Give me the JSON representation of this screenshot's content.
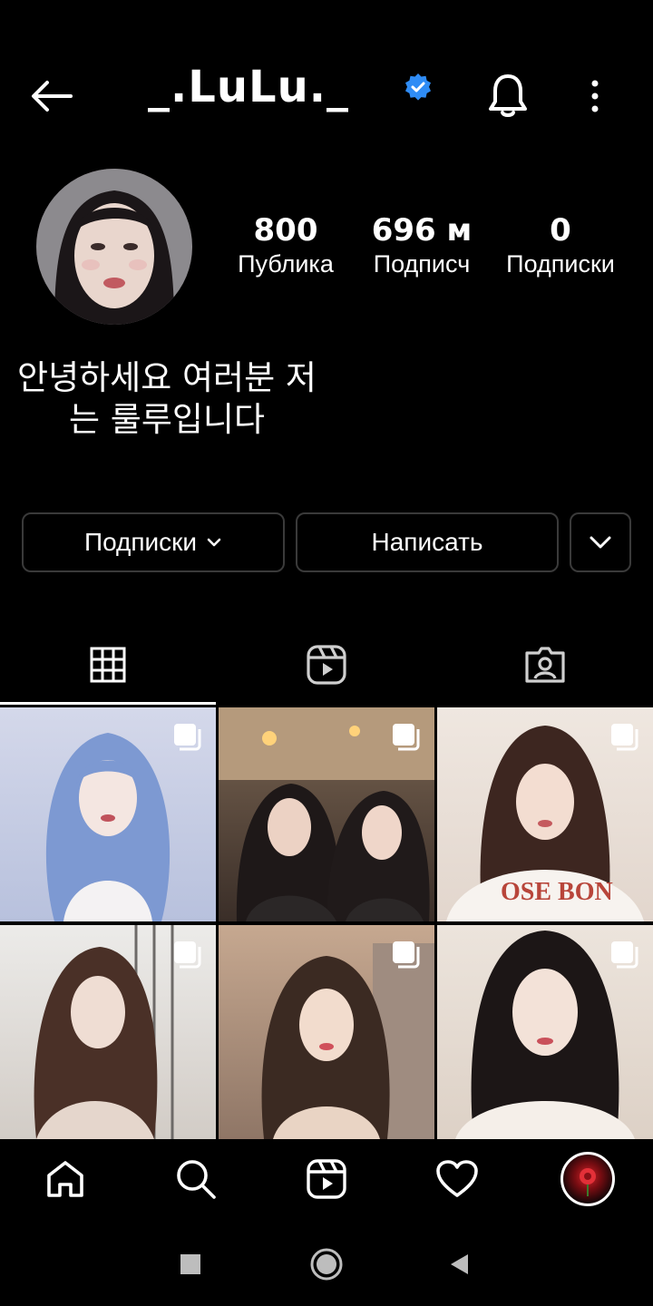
{
  "header": {
    "username": "_.LuLu._",
    "verified_icon": "verified-badge-icon",
    "back_icon": "arrow-left-icon",
    "notification_icon": "bell-icon",
    "more_icon": "more-vertical-icon",
    "verified_color": "#2f8cf5"
  },
  "profile": {
    "avatar": "profile-photo",
    "stats": [
      {
        "value": "800",
        "label": "Публика"
      },
      {
        "value": "696 м",
        "label": "Подписч"
      },
      {
        "value": "0",
        "label": "Подписки"
      }
    ],
    "bio_line1": "안녕하세요 여러분 저",
    "bio_line2": "는 룰루입니다"
  },
  "actions": {
    "following_label": "Подписки",
    "message_label": "Написать",
    "suggest_icon": "chevron-down-icon"
  },
  "tabs": [
    {
      "icon": "grid-icon",
      "active": true
    },
    {
      "icon": "reels-icon",
      "active": false
    },
    {
      "icon": "tagged-icon",
      "active": false
    }
  ],
  "posts": [
    {
      "type": "carousel",
      "palette": [
        "#c3cbe4",
        "#7b9ad4",
        "#f4f2f3"
      ]
    },
    {
      "type": "carousel",
      "palette": [
        "#5b4636",
        "#2b2220",
        "#c79a6f"
      ]
    },
    {
      "type": "carousel",
      "palette": [
        "#e9dfd8",
        "#3d2620",
        "#f7f3ef"
      ]
    },
    {
      "type": "carousel",
      "palette": [
        "#e6e5e3",
        "#4a3027",
        "#cfc8c2"
      ]
    },
    {
      "type": "carousel",
      "palette": [
        "#bfa28b",
        "#3b2a22",
        "#e3cbb8"
      ]
    },
    {
      "type": "carousel",
      "palette": [
        "#e7ded5",
        "#1c1616",
        "#f5efe9"
      ]
    }
  ],
  "bottom_nav": [
    "home-icon",
    "search-icon",
    "reels-icon",
    "heart-icon",
    "profile-avatar"
  ],
  "system_nav": [
    "recent-apps-icon",
    "home-circle-icon",
    "back-triangle-icon"
  ]
}
